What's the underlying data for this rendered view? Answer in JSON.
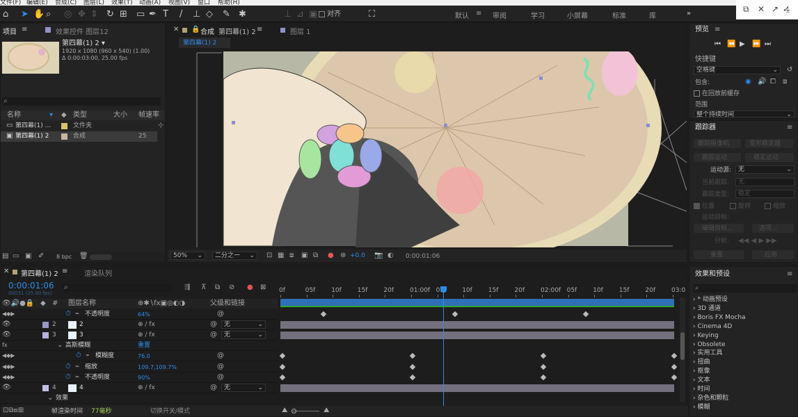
{
  "menu": [
    "文件(F)",
    "编辑(E)",
    "合成(C)",
    "图层(L)",
    "效果(T)",
    "动画(A)",
    "视图(V)",
    "窗口",
    "帮助(H)"
  ],
  "toolbar": {
    "align_label": "对齐",
    "workspaces": [
      "默认",
      "审阅",
      "学习",
      "小屏幕",
      "标准",
      "库"
    ],
    "active_workspace": "默认"
  },
  "project": {
    "tab": "项目",
    "effect_tab": "效果控件 图层12",
    "item_name": "第四幕(1) 2 ▾",
    "item_size": "1920 x 1080 (960 x 540) (1.00)",
    "item_duration": "Δ 0:00:03:00, 25.00 fps",
    "columns": [
      "名称",
      "类型",
      "大小",
      "帧速率"
    ],
    "rows": [
      {
        "name": "第四幕(1) ...",
        "type": "文件夹",
        "fps": ""
      },
      {
        "name": "第四幕(1) 2",
        "type": "合成",
        "fps": "25"
      }
    ],
    "bpc": "8 bpc"
  },
  "comp": {
    "tab_prefix": "合成",
    "tab_name": "第四幕(1) 2",
    "layer_tab": "图层 1",
    "breadcrumb": "第四幕(1) 2",
    "zoom": "50%",
    "resolution": "二分之一",
    "exposure": "+0.0",
    "timecode": "0:00:01:06"
  },
  "preview": {
    "title": "预览",
    "shortcut_label": "快捷键",
    "shortcut_value": "空格键",
    "include_label": "包含:",
    "cache_label": "在回放前缓存",
    "range_label": "范围",
    "range_value": "整个持续时间"
  },
  "tracker": {
    "title": "跟踪器",
    "btn1": "跟踪摄像机",
    "btn2": "变形稳定器",
    "btn3": "跟踪运动",
    "btn4": "稳定运动",
    "source_label": "运动源:",
    "source_value": "无",
    "current_label": "当前跟踪:",
    "current_value": "无",
    "type_label": "跟踪类型:",
    "type_value": "稳定",
    "position": "位置",
    "rotation": "旋转",
    "scale": "缩放",
    "target_label": "运动目标:",
    "edit_target": "编辑目标...",
    "options": "选项...",
    "analyze": "分析:",
    "reset": "重置",
    "apply": "应用"
  },
  "effects": {
    "title": "效果和预设",
    "items": [
      "* 动画预设",
      "3D 通道",
      "Boris FX Mocha",
      "Cinema 4D",
      "Keying",
      "Obsolete",
      "实用工具",
      "扭曲",
      "抠像",
      "文本",
      "时间",
      "杂色和颗粒",
      "模糊"
    ]
  },
  "timeline": {
    "tab": "第四幕(1) 2",
    "render_tab": "渲染队列",
    "timecode": "0:00:01:06",
    "sub_timecode": "00031 (25.00 fps)",
    "layer_header": "图层名称",
    "parent_header": "父级和链接",
    "ruler": [
      "0f",
      "05f",
      "10f",
      "15f",
      "20f",
      "01:00f",
      "05f",
      "10f",
      "15f",
      "20f",
      "02:00f",
      "05f",
      "10f",
      "15f",
      "20f",
      "03:0"
    ],
    "rows": [
      {
        "num": "",
        "name": "不透明度",
        "value": "64%"
      },
      {
        "num": "2",
        "name": "2",
        "parent": "无"
      },
      {
        "num": "3",
        "name": "3",
        "parent": "无"
      },
      {
        "num": "",
        "name": "高斯模糊",
        "value": "重置"
      },
      {
        "num": "",
        "name": "模糊度",
        "value": "76.0"
      },
      {
        "num": "",
        "name": "缩放",
        "value": "109.7,109.7%"
      },
      {
        "num": "",
        "name": "不透明度",
        "value": "90%"
      },
      {
        "num": "4",
        "name": "4",
        "parent": "无"
      },
      {
        "num": "",
        "name": "效果",
        "value": ""
      }
    ],
    "render_time_label": "帧渲染时间",
    "render_time_value": "77毫秒",
    "switch_label": "切换开关/模式"
  }
}
